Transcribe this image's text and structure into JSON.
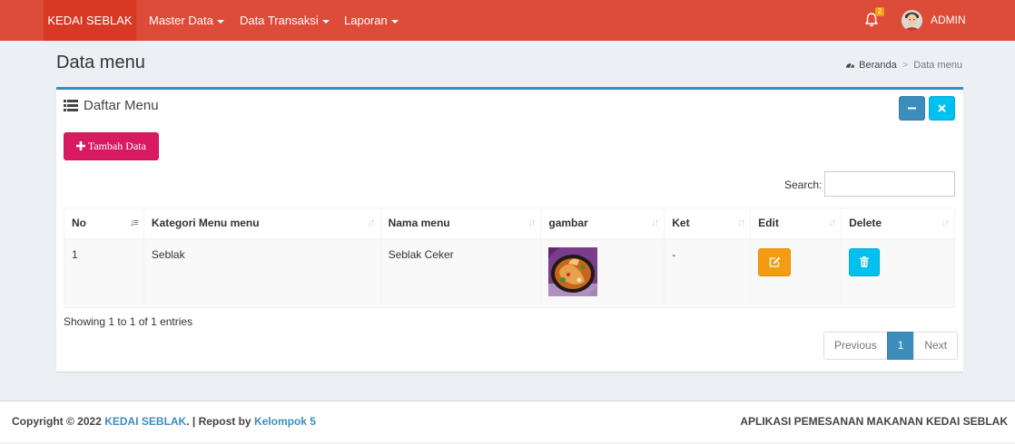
{
  "navbar": {
    "brand": "KEDAI SEBLAK",
    "menus": [
      {
        "label": "Master Data"
      },
      {
        "label": "Data Transaksi"
      },
      {
        "label": "Laporan"
      }
    ],
    "notification_count": "2",
    "user_name": "ADMIN",
    "accent_color": "#dd4b39"
  },
  "header": {
    "title": "Data menu",
    "breadcrumb": {
      "home": "Beranda",
      "current": "Data menu"
    }
  },
  "box": {
    "title": "Daftar Menu",
    "add_button": "Tambah Data",
    "search": {
      "label": "Search:",
      "value": "",
      "placeholder": ""
    },
    "table": {
      "columns": [
        "No",
        "Kategori Menu menu",
        "Nama menu",
        "gambar",
        "Ket",
        "Edit",
        "Delete"
      ],
      "rows": [
        {
          "no": "1",
          "kategori": "Seblak",
          "nama": "Seblak Ceker",
          "gambar": "seblak-ceker-image",
          "ket": "-"
        }
      ]
    },
    "info": "Showing 1 to 1 of 1 entries",
    "pagination": {
      "previous": "Previous",
      "current": "1",
      "next": "Next"
    }
  },
  "footer": {
    "copyright_prefix": "Copyright © 2022",
    "brand_link": "KEDAI SEBLAK",
    "repost_text": ". | Repost by",
    "team_link": "Kelompok 5",
    "app_name": "APLIKASI PEMESANAN MAKANAN KEDAI SEBLAK"
  }
}
